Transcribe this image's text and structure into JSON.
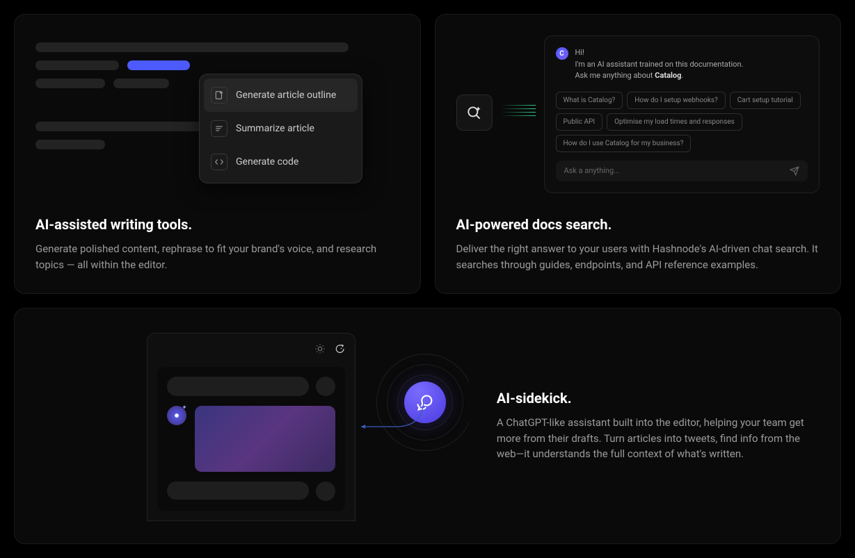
{
  "cards": {
    "writing": {
      "title": "AI-assisted writing tools.",
      "desc": "Generate polished content, rephrase to fit your brand's voice, and research topics — all within the editor.",
      "menu": [
        {
          "label": "Generate article outline"
        },
        {
          "label": "Summarize article"
        },
        {
          "label": "Generate code"
        }
      ]
    },
    "search": {
      "title": "AI-powered docs search.",
      "desc": "Deliver the right answer to your users with Hashnode's AI-driven chat search. It searches through guides, endpoints, and API reference examples.",
      "greeting": "Hi!",
      "intro1": "I'm an AI assistant trained on this documentation.",
      "intro2_prefix": "Ask me anything about ",
      "intro2_bold": "Catalog",
      "intro2_suffix": ".",
      "chips": [
        "What is Catalog?",
        "How do I setup webhooks?",
        "Cart setup tutorial",
        "Public API",
        "Optimise my load times and responses",
        "How do I use Catalog for my business?"
      ],
      "input_placeholder": "Ask a anything...",
      "avatar_letter": "C"
    },
    "sidekick": {
      "title": "AI-sidekick.",
      "desc": "A ChatGPT-like assistant built into the editor, helping your team get more from their drafts. Turn articles into tweets, find info from the web—it understands the full context of what's written."
    }
  }
}
